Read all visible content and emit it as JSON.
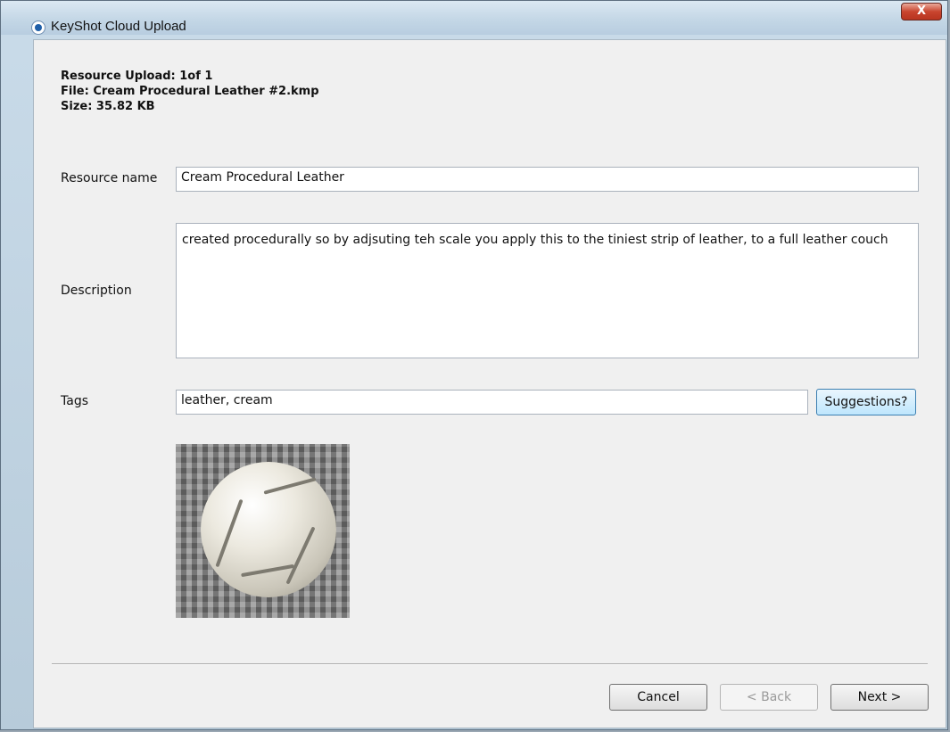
{
  "window": {
    "title": "KeyShot Cloud Upload",
    "close_label": "X"
  },
  "info": {
    "upload": "Resource Upload: 1of 1",
    "file": "File: Cream Procedural Leather #2.kmp",
    "size": "Size: 35.82 KB"
  },
  "form": {
    "resource_name_label": "Resource name",
    "resource_name_value": "Cream Procedural Leather",
    "description_label": "Description",
    "description_value": "created procedurally so by adjsuting teh scale you apply this to the tiniest strip of leather, to a full leather couch",
    "tags_label": "Tags",
    "tags_value": "leather, cream",
    "suggestions_label": "Suggestions?"
  },
  "buttons": {
    "cancel": "Cancel",
    "back": "< Back",
    "next": "Next >"
  }
}
